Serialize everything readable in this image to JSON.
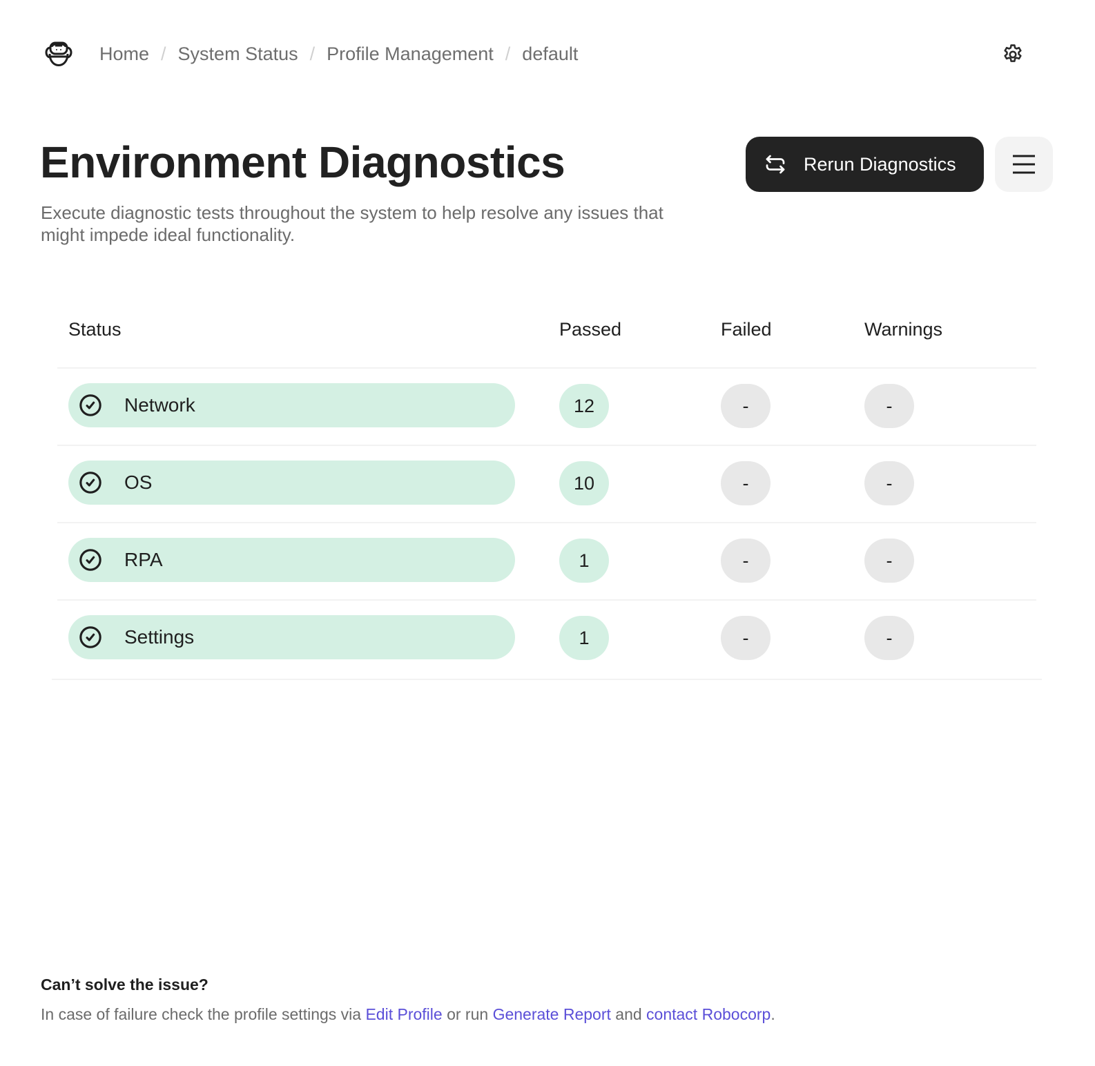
{
  "header": {
    "logo_icon": "robocorp-logo-icon",
    "breadcrumb": [
      {
        "label": "Home"
      },
      {
        "label": "System Status"
      },
      {
        "label": "Profile Management"
      },
      {
        "label": "default"
      }
    ],
    "separator": "/",
    "settings_icon": "gear-icon"
  },
  "main": {
    "title": "Environment Diagnostics",
    "subtitle": "Execute diagnostic tests throughout the system to help resolve any issues that might impede ideal functionality.",
    "rerun_button": {
      "label": "Rerun Diagnostics",
      "icon": "repeat-arrows-icon"
    },
    "menu_button": {
      "icon": "hamburger-menu-icon"
    }
  },
  "table": {
    "columns": [
      "Status",
      "Passed",
      "Failed",
      "Warnings"
    ],
    "rows": [
      {
        "name": "Network",
        "status": "passed",
        "passed": "12",
        "failed": "-",
        "warnings": "-"
      },
      {
        "name": "OS",
        "status": "passed",
        "passed": "10",
        "failed": "-",
        "warnings": "-"
      },
      {
        "name": "RPA",
        "status": "passed",
        "passed": "1",
        "failed": "-",
        "warnings": "-"
      },
      {
        "name": "Settings",
        "status": "passed",
        "passed": "1",
        "failed": "-",
        "warnings": "-"
      }
    ]
  },
  "footer": {
    "title": "Can’t solve the issue?",
    "text_prefix": "In case of failure check the profile settings via ",
    "link_edit_profile": "Edit Profile",
    "text_mid1": " or run ",
    "link_generate_report": "Generate Report",
    "text_mid2": " and ",
    "link_contact": "contact Robocorp",
    "text_suffix": "."
  },
  "colors": {
    "success_bg": "#d4f0e3",
    "neutral_bg": "#e8e8e8",
    "primary_button_bg": "#232323",
    "link": "#5b4fd8"
  }
}
